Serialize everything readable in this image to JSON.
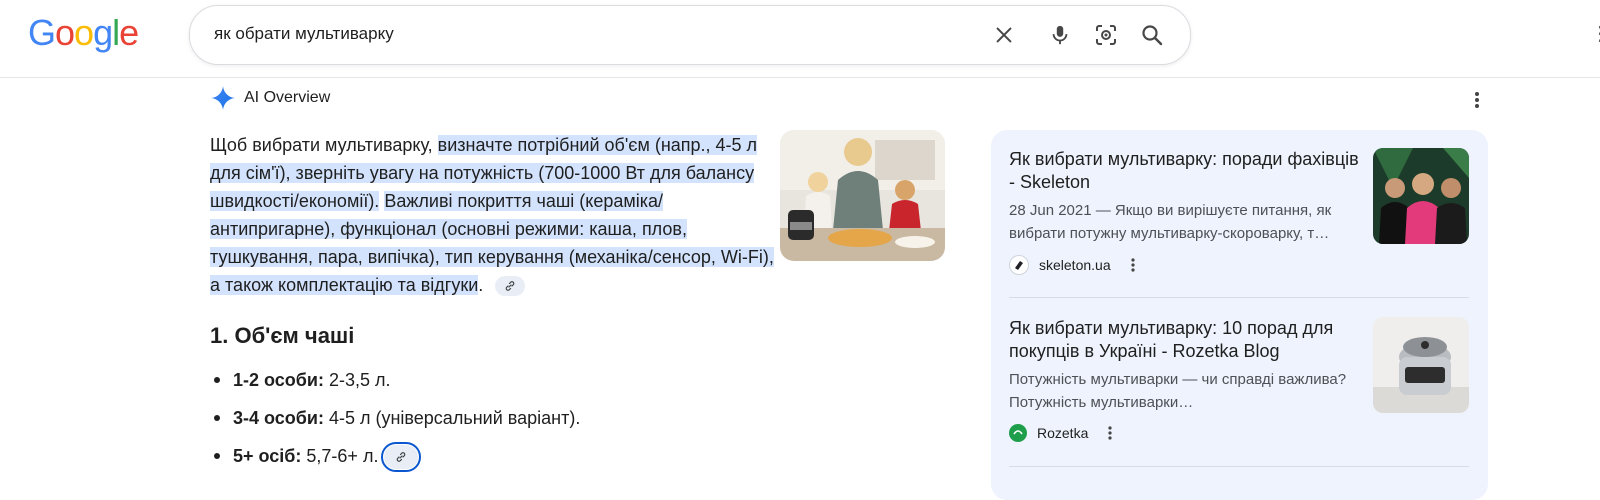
{
  "header": {
    "logo_letters": [
      "G",
      "o",
      "o",
      "g",
      "l",
      "e"
    ],
    "logo_colors": [
      "#4285F4",
      "#EA4335",
      "#FBBC05",
      "#4285F4",
      "#34A853",
      "#EA4335"
    ],
    "search": {
      "query": "як обрати мультиварку",
      "icons": [
        "close-icon",
        "microphone-icon",
        "lens-icon",
        "search-icon"
      ]
    }
  },
  "ai_overview": {
    "title": "AI Overview",
    "paragraph": {
      "lead": "Щоб вибрати мультиварку, ",
      "hl1": "визначте потрібний об'єм (напр., 4-5 л для сім'ї), зверніть увагу на потужність (700-1000 Вт для балансу швидкості/економії).",
      "hl2": "Важливі покриття чаші (кераміка/антипригарне), функціонал (основні режими: каша, плов, тушкування, пара, випічка), тип керування (механіка/сенсор, Wi-Fi), а також комплектацію та відгуки",
      "tail": "."
    },
    "section_title": "1. Об'єм чаші",
    "bullets": [
      {
        "label": "1-2 особи:",
        "text": " 2-3,5 л."
      },
      {
        "label": "3-4 особи:",
        "text": " 4-5 л (універсальний варіант)."
      },
      {
        "label": "5+ осіб:",
        "text": " 5,7-6+ л."
      }
    ]
  },
  "sources": [
    {
      "title": "Як вибрати мультиварку: поради фахівців - Skeleton",
      "snippet": "28 Jun 2021 — Якщо ви вирішуєте питання, як вибрати потужну мультиварку-скороварку, т…",
      "site": "skeleton.ua",
      "favicon_color": "#202124"
    },
    {
      "title": "Як вибрати мультиварку: 10 порад для покупців в Україні - Rozetka Blog",
      "snippet": "Потужність мультиварки — чи справді важлива? Потужність мультиварки…",
      "site": "Rozetka",
      "favicon_color": "#1e9e4a"
    }
  ],
  "colors": {
    "accent": "#0b57d0",
    "highlight": "#d3e3fd",
    "panel": "#eef3fd"
  }
}
